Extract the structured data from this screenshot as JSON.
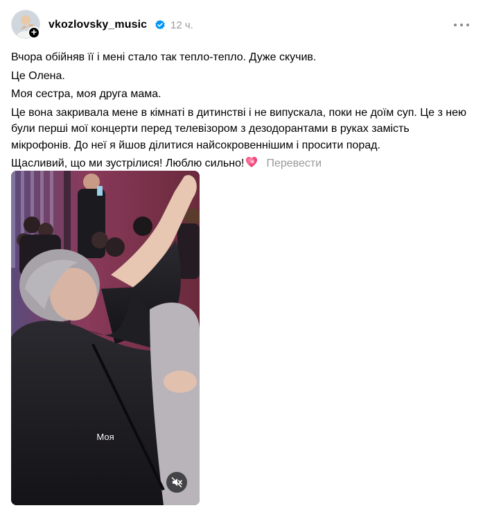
{
  "header": {
    "username": "vkozlovsky_music",
    "timestamp": "12 ч.",
    "avatar_badge": "+",
    "verified_icon": "verified-badge-icon",
    "more_icon": "more-horizontal-icon"
  },
  "body": {
    "lines": [
      "Вчора обійняв її і мені стало так тепло-тепло. Дуже скучив.",
      "Це Олена.",
      "Моя сестра, моя друга мама.",
      "Це вона закривала мене в кімнаті в дитинстві і не випускала, поки не доїм суп. Це з нею були перші мої концерти перед телевізором з дезодорантами в руках замість мікрофонів. До неї я йшов ділитися найсокровеннішим і просити порад.",
      "Щасливий, що ми зустрілися! Люблю сильно!"
    ],
    "translate_label": "Перевести"
  },
  "video": {
    "caption": "Моя",
    "mute_icon": "speaker-muted-icon"
  },
  "colors": {
    "accent_verified": "#0095f6",
    "secondary_text": "#999999",
    "heart": "#f0387a"
  }
}
